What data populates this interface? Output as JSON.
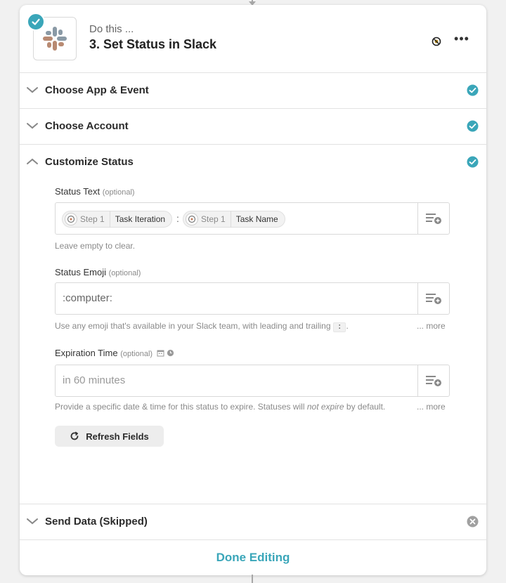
{
  "header": {
    "subtitle": "Do this ...",
    "title": "3. Set Status in Slack"
  },
  "sections": {
    "app_event": {
      "label": "Choose App & Event",
      "status": "complete"
    },
    "account": {
      "label": "Choose Account",
      "status": "complete"
    },
    "customize": {
      "label": "Customize Status",
      "status": "complete"
    },
    "send_data": {
      "label": "Send Data (Skipped)",
      "status": "skipped"
    }
  },
  "fields": {
    "status_text": {
      "label": "Status Text",
      "optional": "(optional)",
      "pills": [
        {
          "step": "Step 1",
          "name": "Task Iteration"
        },
        {
          "step": "Step 1",
          "name": "Task Name"
        }
      ],
      "separator": ":",
      "help": "Leave empty to clear."
    },
    "status_emoji": {
      "label": "Status Emoji",
      "optional": "(optional)",
      "value": ":computer:",
      "help_prefix": "Use any emoji that's available in your Slack team, with leading and trailing",
      "help_code": ":",
      "help_suffix": ".",
      "more": "... more"
    },
    "expiration": {
      "label": "Expiration Time",
      "optional": "(optional)",
      "placeholder": "in 60 minutes",
      "help_prefix": "Provide a specific date & time for this status to expire. Statuses will",
      "help_em": "not expire",
      "help_suffix": "by default.",
      "more": "... more"
    }
  },
  "buttons": {
    "refresh": "Refresh Fields",
    "done": "Done Editing"
  },
  "colors": {
    "accent": "#3aa6b9",
    "skipped": "#a0a0a0"
  },
  "icons": {
    "app": "slack-icon",
    "check": "check-circle-icon",
    "skip": "x-circle-icon",
    "insert": "insert-data-icon",
    "refresh": "refresh-icon",
    "date": "calendar-icon",
    "time": "clock-icon"
  }
}
